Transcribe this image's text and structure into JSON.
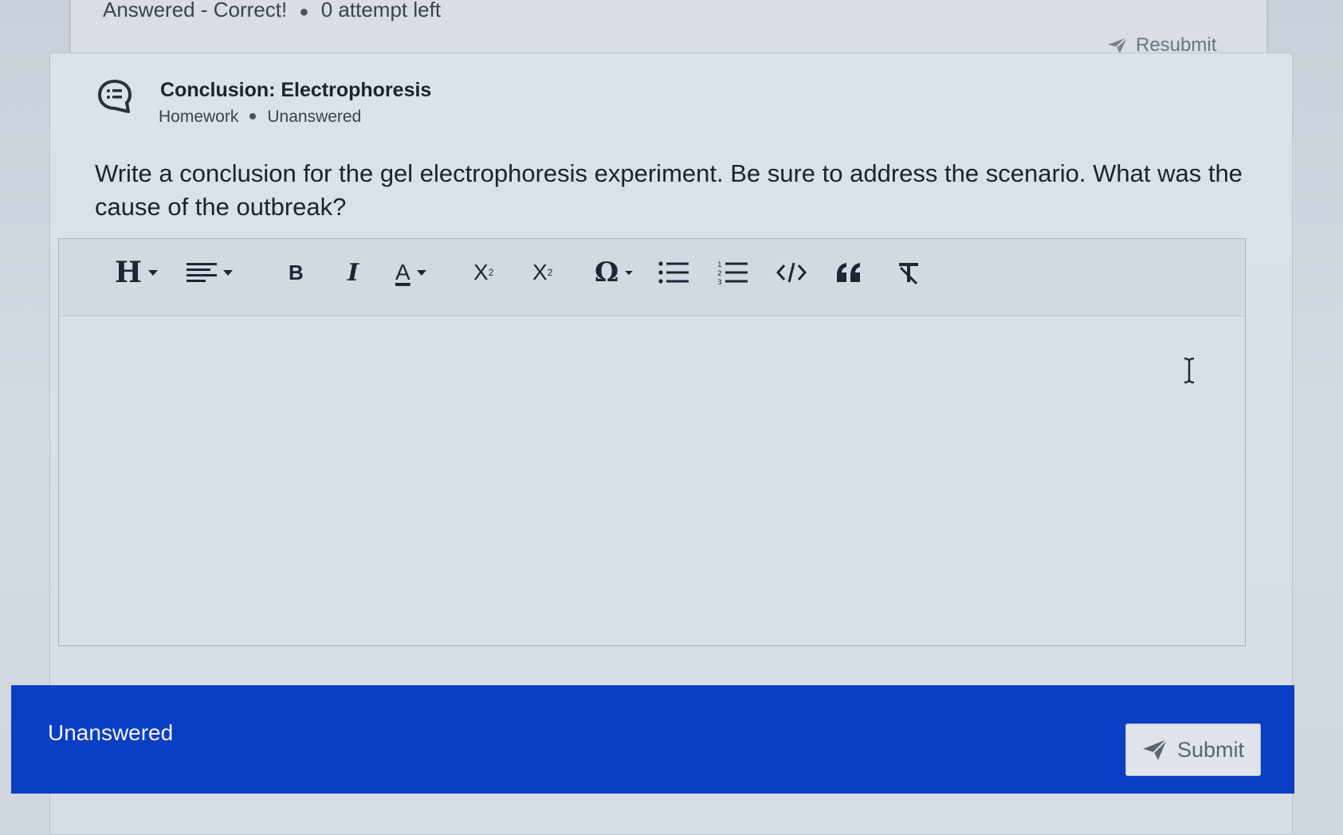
{
  "previous_question": {
    "status": "Answered - Correct!",
    "attempts": "0 attempt left",
    "resubmit_label": "Resubmit"
  },
  "question": {
    "title": "Conclusion: Electrophoresis",
    "type": "Homework",
    "status": "Unanswered",
    "prompt": "Write a conclusion for the gel electrophoresis experiment. Be sure to address the scenario. What was the cause of the outbreak?"
  },
  "toolbar": {
    "heading_label": "H",
    "bold_label": "B",
    "italic_label": "I",
    "font_color_label": "A",
    "subscript_label": "X",
    "superscript_label": "X",
    "special_char_label": "Ω"
  },
  "editor": {
    "value": ""
  },
  "footer": {
    "status": "Unanswered",
    "submit_label": "Submit",
    "bar_color": "#0a3fc3"
  }
}
